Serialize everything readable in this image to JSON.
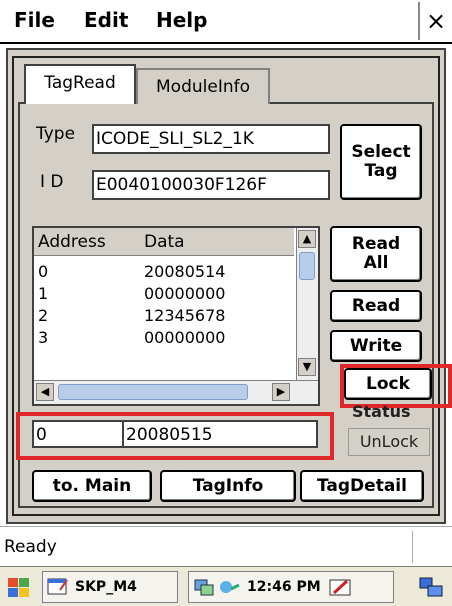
{
  "menu": {
    "file_label": "File",
    "edit_label": "Edit",
    "help_label": "Help",
    "close_label": "×"
  },
  "tabs": [
    {
      "label": "TagRead"
    },
    {
      "label": "ModuleInfo"
    }
  ],
  "tag": {
    "type_label": "Type",
    "type_value": "ICODE_SLI_SL2_1K",
    "id_label": "I D",
    "id_value": "E0040100030F126F"
  },
  "buttons": {
    "select_tag_line1": "Select",
    "select_tag_line2": "Tag",
    "read_all_line1": "Read",
    "read_all_line2": "All",
    "read": "Read",
    "write": "Write",
    "lock": "Lock",
    "to_main": "to. Main",
    "tag_info": "TagInfo",
    "tag_detail": "TagDetail"
  },
  "list": {
    "columns": [
      "Address",
      "Data"
    ],
    "rows": [
      {
        "address": "0",
        "data": "20080514"
      },
      {
        "address": "1",
        "data": "00000000"
      },
      {
        "address": "2",
        "data": "12345678"
      },
      {
        "address": "3",
        "data": "00000000"
      }
    ]
  },
  "edit": {
    "address_value": "0",
    "data_value": "20080515"
  },
  "status": {
    "label": "Status",
    "value": "UnLock"
  },
  "statusbar": {
    "text": "Ready"
  },
  "taskbar": {
    "app_label": "SKP_M4",
    "time": "12:46 PM"
  },
  "colors": {
    "highlight": "#e0282a",
    "dialog_bg": "#d4d0c8"
  }
}
